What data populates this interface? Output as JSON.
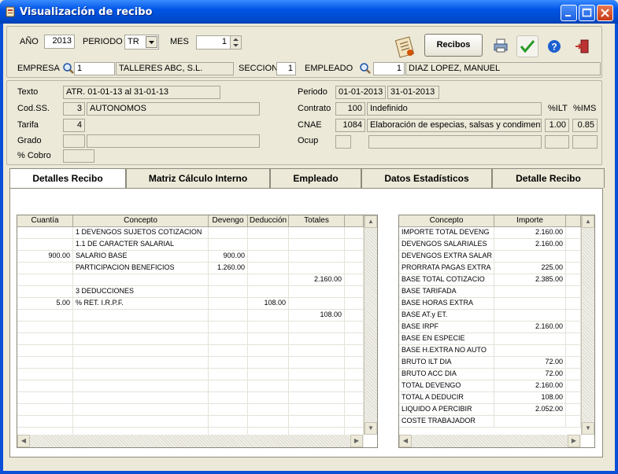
{
  "window": {
    "title": "Visualización de recibo"
  },
  "header": {
    "anio_label": "AÑO",
    "anio_value": "2013",
    "periodo_label": "PERIODO",
    "periodo_value": "TR",
    "mes_label": "MES",
    "mes_value": "1",
    "recibos_button": "Recibos",
    "empresa_label": "EMPRESA",
    "empresa_code": "1",
    "empresa_name": "TALLERES ABC, S.L.",
    "seccion_label": "SECCION",
    "seccion_value": "1",
    "empleado_label": "EMPLEADO",
    "empleado_code": "1",
    "empleado_name": "DIAZ  LOPEZ, MANUEL"
  },
  "info": {
    "texto_label": "Texto",
    "texto_value": "ATR. 01-01-13 al 31-01-13",
    "codss_label": "Cod.SS.",
    "codss_code": "3",
    "codss_name": "AUTONOMOS",
    "tarifa_label": "Tarifa",
    "tarifa_value": "4",
    "grado_label": "Grado",
    "grado_code": "",
    "grado_name": "",
    "cobro_label": "% Cobro",
    "cobro_value": "",
    "periodo_label": "Periodo",
    "periodo_from": "01-01-2013",
    "periodo_to": "31-01-2013",
    "contrato_label": "Contrato",
    "contrato_code": "100",
    "contrato_name": "Indefinido",
    "ilt_label": "%ILT",
    "ims_label": "%IMS",
    "cnae_label": "CNAE",
    "cnae_code": "1084",
    "cnae_name": "Elaboración de especias, salsas y condiment",
    "ilt_value": "1.00",
    "ims_value": "0.85",
    "ocup_label": "Ocup",
    "ocup_code": "",
    "ocup_name": "",
    "ocup_a": "",
    "ocup_b": ""
  },
  "tabs": [
    {
      "label": "Detalles Recibo",
      "active": true
    },
    {
      "label": "Matriz Cálculo Interno",
      "active": false
    },
    {
      "label": "Empleado",
      "active": false
    },
    {
      "label": "Datos Estadísticos",
      "active": false
    },
    {
      "label": "Detalle Recibo",
      "active": false
    }
  ],
  "left_grid": {
    "headers": [
      "Cuantía",
      "Concepto",
      "Devengo",
      "Deducción",
      "Totales"
    ],
    "rows": [
      [
        "",
        "1 DEVENGOS SUJETOS COTIZACION",
        "",
        "",
        ""
      ],
      [
        "",
        "1.1 DE CARACTER SALARIAL",
        "",
        "",
        ""
      ],
      [
        "900.00",
        "SALARIO BASE",
        "900.00",
        "",
        ""
      ],
      [
        "",
        "PARTICIPACION BENEFICIOS",
        "1.260.00",
        "",
        ""
      ],
      [
        "",
        "",
        "",
        "",
        "2.160.00"
      ],
      [
        "",
        "3 DEDUCCIONES",
        "",
        "",
        ""
      ],
      [
        "5.00",
        "% RET. I.R.P.F.",
        "",
        "108.00",
        ""
      ],
      [
        "",
        "",
        "",
        "",
        "108.00"
      ],
      [
        "",
        "",
        "",
        "",
        ""
      ],
      [
        "",
        "",
        "",
        "",
        ""
      ],
      [
        "",
        "",
        "",
        "",
        ""
      ],
      [
        "",
        "",
        "",
        "",
        ""
      ],
      [
        "",
        "",
        "",
        "",
        ""
      ],
      [
        "",
        "",
        "",
        "",
        ""
      ],
      [
        "",
        "",
        "",
        "",
        ""
      ],
      [
        "",
        "",
        "",
        "",
        ""
      ],
      [
        "",
        "",
        "",
        "",
        ""
      ],
      [
        "",
        "",
        "",
        "",
        ""
      ]
    ]
  },
  "right_grid": {
    "headers": [
      "Concepto",
      "Importe"
    ],
    "rows": [
      [
        "IMPORTE TOTAL DEVENG",
        "2.160.00"
      ],
      [
        "DEVENGOS SALARIALES",
        "2.160.00"
      ],
      [
        "DEVENGOS EXTRA SALAR",
        ""
      ],
      [
        "PRORRATA PAGAS EXTRA",
        "225.00"
      ],
      [
        "BASE TOTAL COTIZACIO",
        "2.385.00"
      ],
      [
        "BASE TARIFADA",
        ""
      ],
      [
        "BASE HORAS EXTRA",
        ""
      ],
      [
        "BASE AT.y ET.",
        ""
      ],
      [
        "BASE IRPF",
        "2.160.00"
      ],
      [
        "BASE EN ESPECIE",
        ""
      ],
      [
        "BASE H.EXTRA NO AUTO",
        ""
      ],
      [
        "BRUTO ILT DIA",
        "72.00"
      ],
      [
        "BRUTO ACC DIA",
        "72.00"
      ],
      [
        "TOTAL DEVENGO",
        "2.160.00"
      ],
      [
        "TOTAL A DEDUCIR",
        "108.00"
      ],
      [
        "LIQUIDO A PERCIBIR",
        "2.052.00"
      ],
      [
        "COSTE TRABAJADOR",
        ""
      ]
    ]
  }
}
